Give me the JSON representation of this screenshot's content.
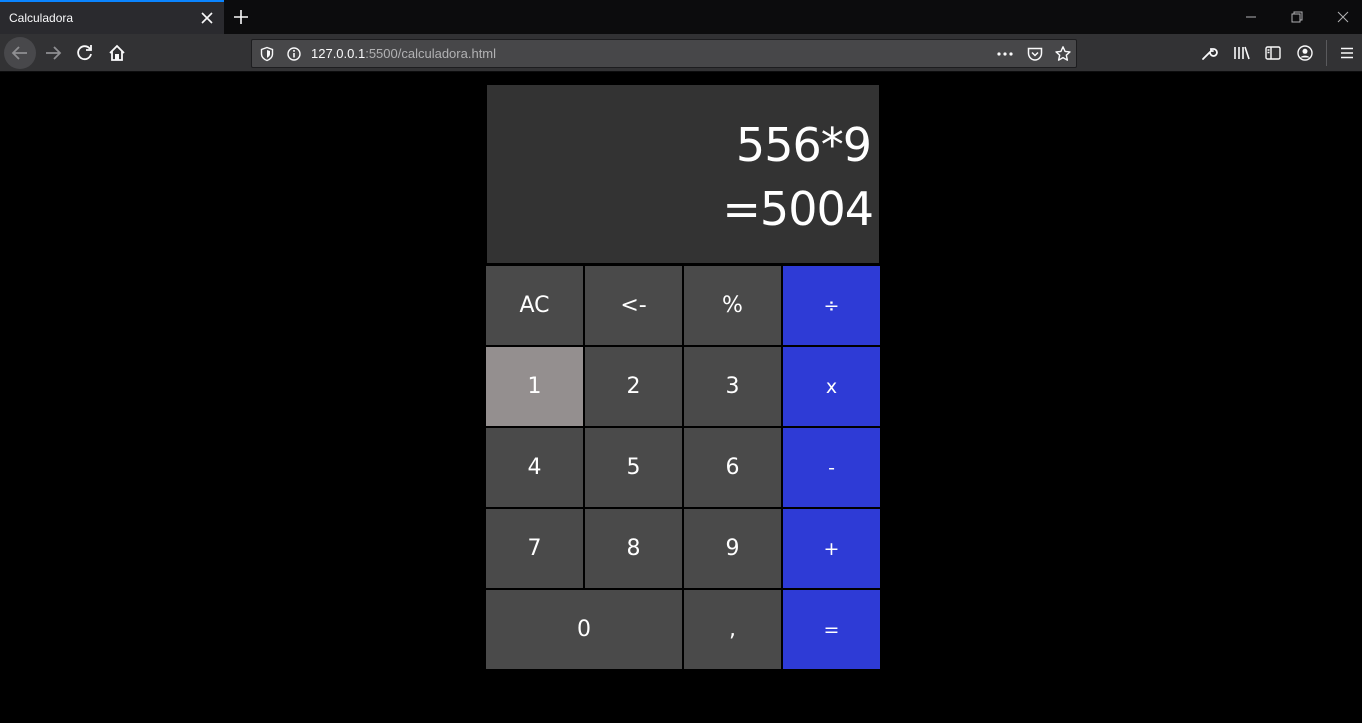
{
  "browser": {
    "tab_title": "Calculadora",
    "url_host": "127.0.0.1",
    "url_path": ":5500/calculadora.html"
  },
  "calculator": {
    "expression": "556*9",
    "result": "=5004",
    "keys": {
      "ac": "AC",
      "backspace": "<-",
      "percent": "%",
      "divide": "÷",
      "one": "1",
      "two": "2",
      "three": "3",
      "multiply": "x",
      "four": "4",
      "five": "5",
      "six": "6",
      "minus": "-",
      "seven": "7",
      "eight": "8",
      "nine": "9",
      "plus": "+",
      "zero": "0",
      "comma": ",",
      "equals": "="
    },
    "colors": {
      "display": "#333333",
      "key": "#4a4a4a",
      "operator": "#2e3bd6",
      "active_key": "#948f8f"
    }
  }
}
